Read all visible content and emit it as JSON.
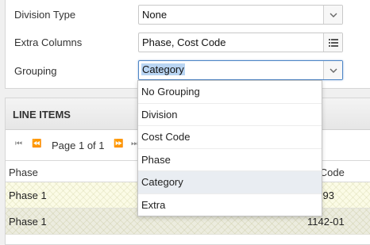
{
  "settings": {
    "division_type": {
      "label": "Division Type",
      "value": "None"
    },
    "extra_columns": {
      "label": "Extra Columns",
      "value": "Phase, Cost Code"
    },
    "grouping": {
      "label": "Grouping",
      "value": "Category"
    }
  },
  "line_items": {
    "title": "LINE ITEMS",
    "pager": {
      "page_text": "Page 1 of 1"
    },
    "columns": [
      "Phase",
      "st Code"
    ],
    "rows": [
      {
        "phase": "Phase 1",
        "cost_code": "1-93"
      },
      {
        "phase": "Phase 1",
        "cost_code": "1142-01"
      }
    ]
  },
  "grouping_dropdown": {
    "options": [
      "No Grouping",
      "Division",
      "Cost Code",
      "Phase",
      "Category",
      "Extra"
    ],
    "highlighted": "Category"
  },
  "colors": {
    "focus_border": "#4f86c6",
    "selection": "#b9d5f3",
    "row_highlight": "#fbfbe6"
  }
}
